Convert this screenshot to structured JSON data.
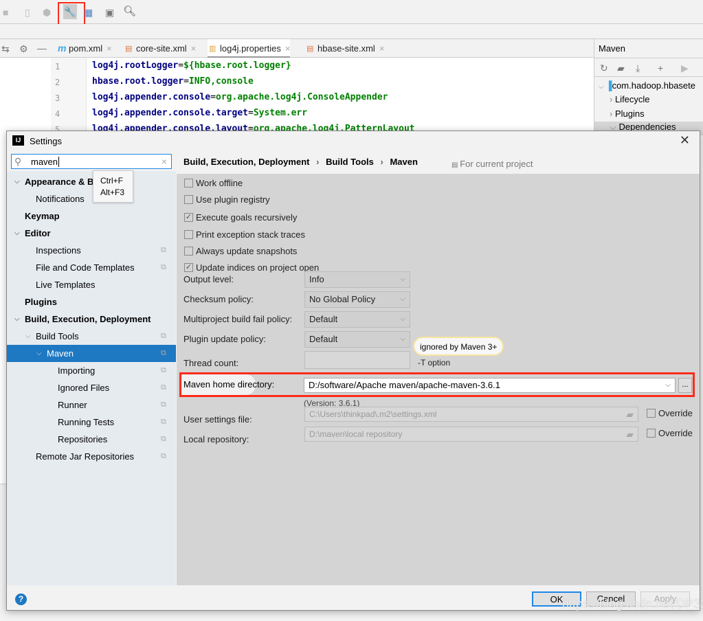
{
  "ide": {
    "tabs": [
      {
        "label": "pom.xml",
        "icon": "maven-icon"
      },
      {
        "label": "core-site.xml",
        "icon": "xml-icon"
      },
      {
        "label": "log4j.properties",
        "icon": "properties-icon"
      },
      {
        "label": "hbase-site.xml",
        "icon": "xml-icon"
      }
    ],
    "code_lines": [
      {
        "num": "1",
        "key": "log4j.rootLogger",
        "eq": "=",
        "val": "${hbase.root.logger}"
      },
      {
        "num": "2",
        "key": "hbase.root.logger",
        "eq": "=",
        "val": "INFO,console"
      },
      {
        "num": "3",
        "key": "log4j.appender.console",
        "eq": "=",
        "val": "org.apache.log4j.ConsoleAppender"
      },
      {
        "num": "4",
        "key": "log4j.appender.console.target",
        "eq": "=",
        "val": "System.err"
      },
      {
        "num": "5",
        "key": "log4j.appender.console.layout",
        "eq": "=",
        "val": "org.apache.log4j.PatternLayout"
      }
    ],
    "maven_panel": {
      "title": "Maven",
      "project": "com.hadoop.hbasete",
      "items": [
        "Lifecycle",
        "Plugins",
        "Dependencies"
      ]
    }
  },
  "dialog": {
    "title": "Settings",
    "search_value": "maven",
    "tooltip": [
      "Ctrl+F",
      "Alt+F3"
    ],
    "tree": [
      {
        "label": "Appearance & B",
        "level": 0,
        "bold": true,
        "arrow": true
      },
      {
        "label": "Notifications",
        "level": 1
      },
      {
        "label": "Keymap",
        "level": 0,
        "bold": true
      },
      {
        "label": "Editor",
        "level": 0,
        "bold": true,
        "arrow": true
      },
      {
        "label": "Inspections",
        "level": 1,
        "copy": true
      },
      {
        "label": "File and Code Templates",
        "level": 1,
        "copy": true
      },
      {
        "label": "Live Templates",
        "level": 1
      },
      {
        "label": "Plugins",
        "level": 0,
        "bold": true
      },
      {
        "label": "Build, Execution, Deployment",
        "level": 0,
        "bold": true,
        "arrow": true
      },
      {
        "label": "Build Tools",
        "level": 1,
        "arrow": true,
        "copy": true
      },
      {
        "label": "Maven",
        "level": 2,
        "arrow": true,
        "copy": true,
        "selected": true
      },
      {
        "label": "Importing",
        "level": 3,
        "copy": true
      },
      {
        "label": "Ignored Files",
        "level": 3,
        "copy": true
      },
      {
        "label": "Runner",
        "level": 3,
        "copy": true
      },
      {
        "label": "Running Tests",
        "level": 3,
        "copy": true
      },
      {
        "label": "Repositories",
        "level": 3,
        "copy": true
      },
      {
        "label": "Remote Jar Repositories",
        "level": 1,
        "copy": true
      }
    ],
    "breadcrumb": [
      "Build, Execution, Deployment",
      "Build Tools",
      "Maven"
    ],
    "for_current_project": "For current project",
    "checkboxes": [
      {
        "label": "Work offline",
        "checked": false
      },
      {
        "label": "Use plugin registry",
        "checked": false
      },
      {
        "label": "Execute goals recursively",
        "checked": true
      },
      {
        "label": "Print exception stack traces",
        "checked": false
      },
      {
        "label": "Always update snapshots",
        "checked": false
      },
      {
        "label": "Update indices on project open",
        "checked": true
      }
    ],
    "fields": [
      {
        "label": "Output level:",
        "value": "Info"
      },
      {
        "label": "Checksum policy:",
        "value": "No Global Policy"
      },
      {
        "label": "Multiproject build fail policy:",
        "value": "Default"
      },
      {
        "label": "Plugin update policy:",
        "value": "Default",
        "note": "ignored by Maven 3+"
      }
    ],
    "thread_count": {
      "label": "Thread count:",
      "value": "",
      "note": "-T option"
    },
    "maven_home": {
      "label": "Maven home directory:",
      "value": "D:/software/Apache maven/apache-maven-3.6.1",
      "browse": "...",
      "version": "(Version: 3.6.1)"
    },
    "user_settings": {
      "label": "User settings file:",
      "value": "C:\\Users\\thinkpad\\.m2\\settings.xml",
      "override": "Override"
    },
    "local_repo": {
      "label": "Local repository:",
      "value": "D:\\maven\\local repository",
      "override": "Override"
    },
    "buttons": {
      "ok": "OK",
      "cancel": "Cancel",
      "apply": "Apply"
    },
    "watermark": "https://blog.csdn.net/DP323",
    "highlight_color": "#ff2a1a",
    "selection_color": "#1e78c2"
  }
}
